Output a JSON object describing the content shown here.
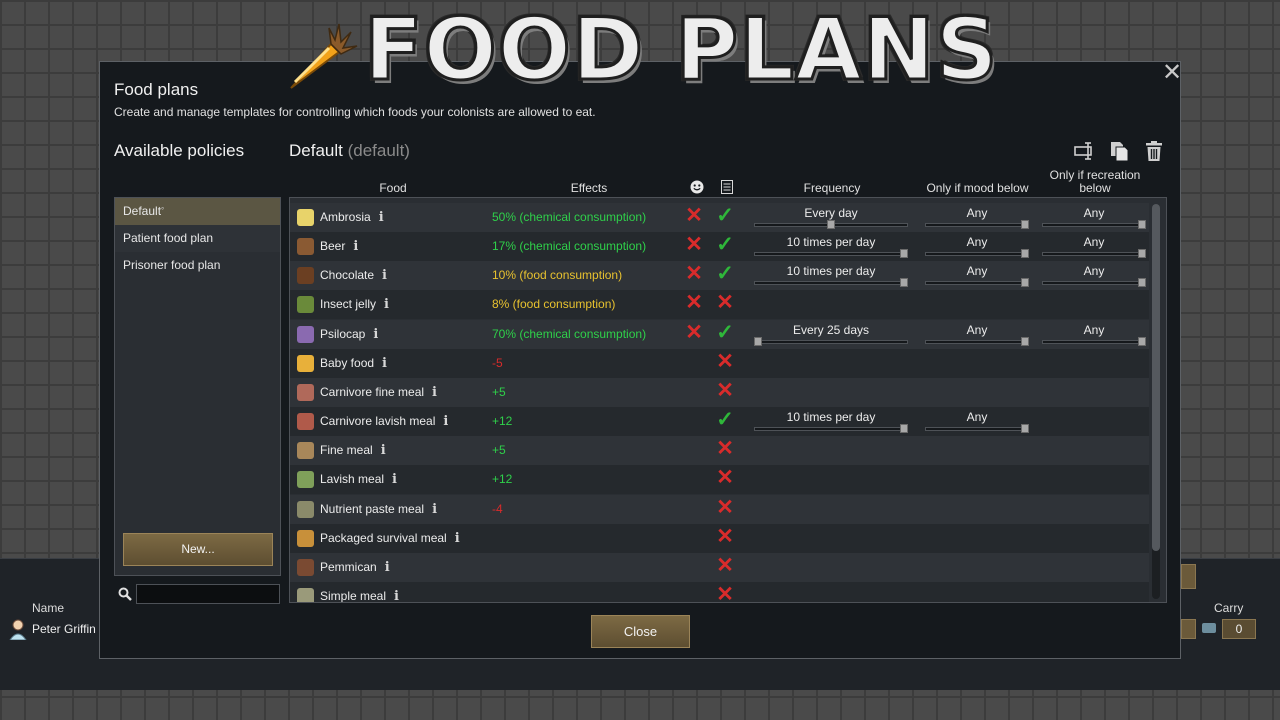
{
  "banner": {
    "title": "FOOD PLANS"
  },
  "window": {
    "title": "Food plans",
    "description": "Create and manage templates for controlling which foods your colonists are allowed to eat.",
    "close_icon": "close-icon"
  },
  "policies": {
    "header": "Available policies",
    "items": [
      {
        "label": "Default",
        "selected": true
      },
      {
        "label": "Patient food plan",
        "selected": false
      },
      {
        "label": "Prisoner food plan",
        "selected": false
      }
    ],
    "new_button": "New...",
    "search_placeholder": ""
  },
  "policy": {
    "name": "Default",
    "default_tag": "(default)",
    "tools": [
      "rename-icon",
      "copy-icon",
      "delete-icon"
    ]
  },
  "table": {
    "columns": {
      "food": "Food",
      "effects": "Effects",
      "mood_icon": "smiley-icon",
      "allowed_icon": "list-icon",
      "frequency": "Frequency",
      "mood_below": "Only if mood below",
      "recreation_below": "Only if recreation below"
    },
    "rows": [
      {
        "name": "Ambrosia",
        "effect": "50% (chemical consumption)",
        "effect_color": "#2fd04a",
        "mood": "x",
        "allowed": "check",
        "frequency": "Every day",
        "freq_level": 0.5,
        "mood_below": "Any",
        "rec_below": "Any",
        "icon_color": "#e8d36a"
      },
      {
        "name": "Beer",
        "effect": "17% (chemical consumption)",
        "effect_color": "#2fd04a",
        "mood": "x",
        "allowed": "check",
        "frequency": "10 times per day",
        "freq_level": 1.0,
        "mood_below": "Any",
        "rec_below": "Any",
        "icon_color": "#8a5a33"
      },
      {
        "name": "Chocolate",
        "effect": "10% (food consumption)",
        "effect_color": "#e8c22f",
        "mood": "x",
        "allowed": "check",
        "frequency": "10 times per day",
        "freq_level": 1.0,
        "mood_below": "Any",
        "rec_below": "Any",
        "icon_color": "#6b3f22"
      },
      {
        "name": "Insect jelly",
        "effect": "8% (food consumption)",
        "effect_color": "#e8c22f",
        "mood": "x",
        "allowed": "x",
        "frequency": "",
        "mood_below": "",
        "rec_below": "",
        "icon_color": "#6a8a3a"
      },
      {
        "name": "Psilocap",
        "effect": "70% (chemical consumption)",
        "effect_color": "#2fd04a",
        "mood": "x",
        "allowed": "check",
        "frequency": "Every 25 days",
        "freq_level": 0.0,
        "mood_below": "Any",
        "rec_below": "Any",
        "icon_color": "#8a6ab0"
      },
      {
        "name": "Baby food",
        "effect": "-5",
        "effect_color": "#d92b2b",
        "mood": "",
        "allowed": "x",
        "frequency": "",
        "mood_below": "",
        "rec_below": "",
        "icon_color": "#e8b03a"
      },
      {
        "name": "Carnivore fine meal",
        "effect": "+5",
        "effect_color": "#2fd04a",
        "mood": "",
        "allowed": "x",
        "frequency": "",
        "mood_below": "",
        "rec_below": "",
        "icon_color": "#b0695a"
      },
      {
        "name": "Carnivore lavish meal",
        "effect": "+12",
        "effect_color": "#2fd04a",
        "mood": "",
        "allowed": "check",
        "frequency": "10 times per day",
        "freq_level": 1.0,
        "mood_below": "Any",
        "rec_below": "",
        "icon_color": "#b05a4a"
      },
      {
        "name": "Fine meal",
        "effect": "+5",
        "effect_color": "#2fd04a",
        "mood": "",
        "allowed": "x",
        "frequency": "",
        "mood_below": "",
        "rec_below": "",
        "icon_color": "#a8875a"
      },
      {
        "name": "Lavish meal",
        "effect": "+12",
        "effect_color": "#2fd04a",
        "mood": "",
        "allowed": "x",
        "frequency": "",
        "mood_below": "",
        "rec_below": "",
        "icon_color": "#7fa05a"
      },
      {
        "name": "Nutrient paste meal",
        "effect": "-4",
        "effect_color": "#d92b2b",
        "mood": "",
        "allowed": "x",
        "frequency": "",
        "mood_below": "",
        "rec_below": "",
        "icon_color": "#8a8a6a"
      },
      {
        "name": "Packaged survival meal",
        "effect": "",
        "effect_color": "#2fd04a",
        "mood": "",
        "allowed": "x",
        "frequency": "",
        "mood_below": "",
        "rec_below": "",
        "icon_color": "#c8903a"
      },
      {
        "name": "Pemmican",
        "effect": "",
        "effect_color": "#2fd04a",
        "mood": "",
        "allowed": "x",
        "frequency": "",
        "mood_below": "",
        "rec_below": "",
        "icon_color": "#7a4a32"
      },
      {
        "name": "Simple meal",
        "effect": "",
        "effect_color": "#2fd04a",
        "mood": "",
        "allowed": "x",
        "frequency": "",
        "mood_below": "",
        "rec_below": "",
        "icon_color": "#9a9a7a"
      }
    ]
  },
  "footer": {
    "close_button": "Close"
  },
  "colonist_bar": {
    "name_header": "Name",
    "carry_header": "Carry",
    "pawn_name": "Peter Griffin",
    "carry_value": "0"
  },
  "colors": {
    "positive": "#2fd04a",
    "warning": "#e8c22f",
    "negative": "#d92b2b",
    "button_brown": "#6b5a3a"
  }
}
